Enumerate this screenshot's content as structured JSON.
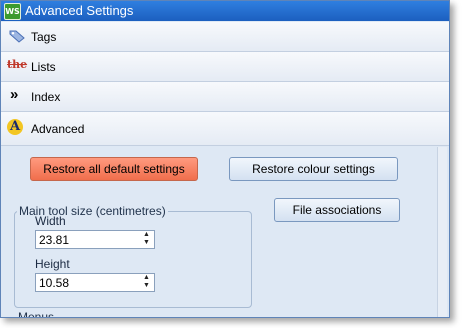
{
  "window": {
    "title": "Advanced Settings",
    "app_icon_text": "WS"
  },
  "sections": [
    {
      "label": "Tags",
      "icon": "tag-icon"
    },
    {
      "label": "Lists",
      "icon": "the-list-icon",
      "icon_text": "the"
    },
    {
      "label": "Index",
      "icon": "double-chevron-right-icon",
      "icon_text": "»"
    },
    {
      "label": "Advanced",
      "icon": "letter-a-icon",
      "icon_text": "A"
    }
  ],
  "advanced": {
    "restore_defaults_label": "Restore all default settings",
    "restore_colour_label": "Restore colour settings",
    "file_associations_label": "File associations",
    "tool_size_group": "Main tool size (centimetres)",
    "width_label": "Width",
    "width_value": "23.81",
    "height_label": "Height",
    "height_value": "10.58",
    "menus_label": "Menus"
  },
  "colors": {
    "titlebar": "#1c5fbf",
    "restore_defaults_button": "#f06e4c",
    "panel": "#dee8f4"
  }
}
